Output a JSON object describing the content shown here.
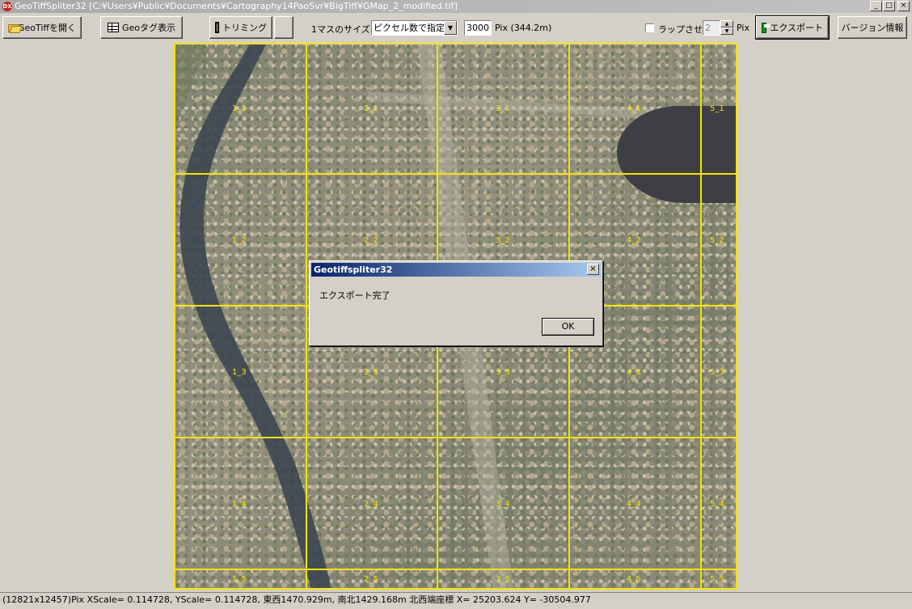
{
  "window": {
    "title": "GeoTiffSpliter32  [C:¥Users¥Public¥Documents¥Cartography14PaoSvr¥BigTiff¥GMap_2_modified.tif]",
    "app_icon_text": "DX",
    "minimize": "_",
    "maximize": "□",
    "close": "×"
  },
  "toolbar": {
    "open_label": "GeoTiffを開く",
    "geotag_label": "Geoタグ表示",
    "trim_label": "トリミング",
    "blank_label": "",
    "cell_size_label": "1マスのサイズ:",
    "size_mode_selected": "ピクセル数で指定",
    "pixel_value": "3000",
    "pixel_info": "Pix (344.2m)",
    "wrap_label": "ラップさせる",
    "wrap_value": "2",
    "wrap_unit": "Pix",
    "export_label": "エクスポート",
    "version_label": "バージョン情報"
  },
  "map": {
    "cells": [
      {
        "label": "1_1"
      },
      {
        "label": "2_1"
      },
      {
        "label": "3_1"
      },
      {
        "label": "4_1"
      },
      {
        "label": "5_1"
      },
      {
        "label": "1_2"
      },
      {
        "label": "2_2"
      },
      {
        "label": "3_2"
      },
      {
        "label": "4_2"
      },
      {
        "label": "5_2"
      },
      {
        "label": "1_3"
      },
      {
        "label": "2_3"
      },
      {
        "label": "3_3"
      },
      {
        "label": "4_3"
      },
      {
        "label": "5_3"
      },
      {
        "label": "1_4"
      },
      {
        "label": "2_4"
      },
      {
        "label": "3_4"
      },
      {
        "label": "4_4"
      },
      {
        "label": "5_4"
      },
      {
        "label": "1_5"
      },
      {
        "label": "2_5"
      },
      {
        "label": "3_5"
      },
      {
        "label": "4_5"
      },
      {
        "label": "5_5"
      }
    ]
  },
  "dialog": {
    "title": "Geotiffspliter32",
    "message": "エクスポート完了",
    "ok_label": "OK",
    "close": "×"
  },
  "status": {
    "text": "(12821x12457)Pix  XScale= 0.114728, YScale= 0.114728, 東西1470.929m, 南北1429.168m  北西端座標 X= 25203.624 Y= -30504.977"
  }
}
